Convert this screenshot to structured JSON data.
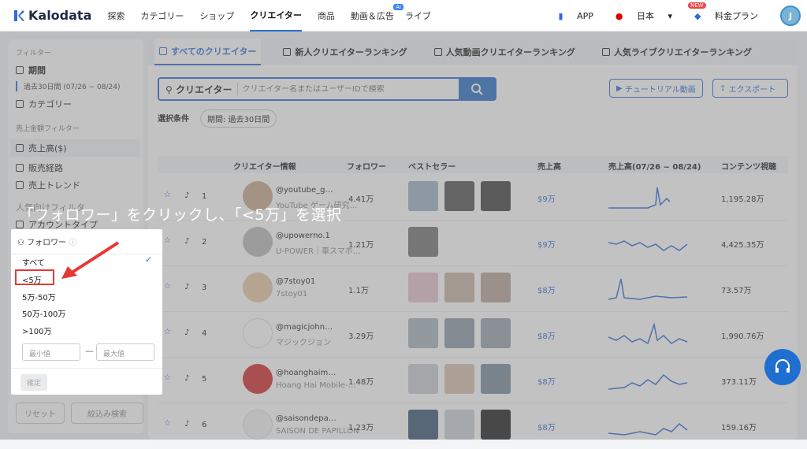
{
  "app": {
    "logo_text": "Kalodata",
    "brand_color": "#2f6cd8"
  },
  "nav": {
    "items": [
      "探索",
      "カテゴリー",
      "ショップ",
      "クリエイター",
      "商品",
      "動画＆広告",
      "ライブ"
    ],
    "ai_badge": "AI",
    "app_label": "APP",
    "lang": "日本",
    "new_badge": "NEW",
    "pricing": "料金プラン",
    "avatar": "J"
  },
  "sidebar": {
    "filter_title": "フィルター",
    "period_label": "期間",
    "period_value": "過去30日間 (07/26 ~ 08/24)",
    "category_label": "カテゴリー",
    "sales_group": "売上金額フィルター",
    "sales_items": [
      "売上高($)",
      "販売経路",
      "売上トレンド"
    ],
    "partial1": "人気向けフィルタ",
    "partial2": "アカウントタイプ",
    "reset": "リセット",
    "search": "絞込み検索"
  },
  "tabs": [
    "すべてのクリエイター",
    "新人クリエイターランキング",
    "人気動画クリエイターランキング",
    "人気ライブクリエイターランキング"
  ],
  "search": {
    "label": "クリエイター",
    "placeholder": "クリエイター名またはユーザーIDで検索"
  },
  "header_buttons": {
    "tutorial": "チュートリアル動画",
    "export": "エクスポート"
  },
  "condition": {
    "label": "選択条件",
    "tag": "期間: 過去30日間"
  },
  "table": {
    "headers": [
      "クリエイター情報",
      "フォロワー",
      "ベストセラー",
      "売上高",
      "売上高(07/26 ~ 08/24)",
      "コンテンツ視聴"
    ],
    "rows": [
      {
        "rank": "1",
        "name": "@youtube_g…",
        "sub": "YouTube ゲーム研究…",
        "followers": "4.41万",
        "sales": "$9万",
        "views": "1,195.28万"
      },
      {
        "rank": "2",
        "name": "@upowerno.1",
        "sub": "U-POWER｜車スマホ…",
        "followers": "1.21万",
        "sales": "$9万",
        "views": "4,425.35万"
      },
      {
        "rank": "3",
        "name": "@7stoy01",
        "sub": "7stoy01",
        "followers": "1.1万",
        "sales": "$8万",
        "views": "73.57万"
      },
      {
        "rank": "4",
        "name": "@magicjohn…",
        "sub": "マジックジョン",
        "followers": "3.29万",
        "sales": "$8万",
        "views": "1,990.76万"
      },
      {
        "rank": "5",
        "name": "@hoanghaim…",
        "sub": "Hoang Hai Mobile-…",
        "followers": "1.48万",
        "sales": "$8万",
        "views": "373.11万"
      },
      {
        "rank": "6",
        "name": "@saisondepa…",
        "sub": "SAISON DE PAPILLON",
        "followers": "1.23万",
        "sales": "$8万",
        "views": "159.16万"
      }
    ]
  },
  "popup": {
    "title": "フォロワー",
    "options": [
      "すべて",
      "<5万",
      "5万-50万",
      "50万-100万",
      ">100万"
    ],
    "min_placeholder": "最小値",
    "max_placeholder": "最大値",
    "dash": "—",
    "confirm": "確定"
  },
  "caption": "「フォロワー」をクリックし、「<5万」を選択"
}
